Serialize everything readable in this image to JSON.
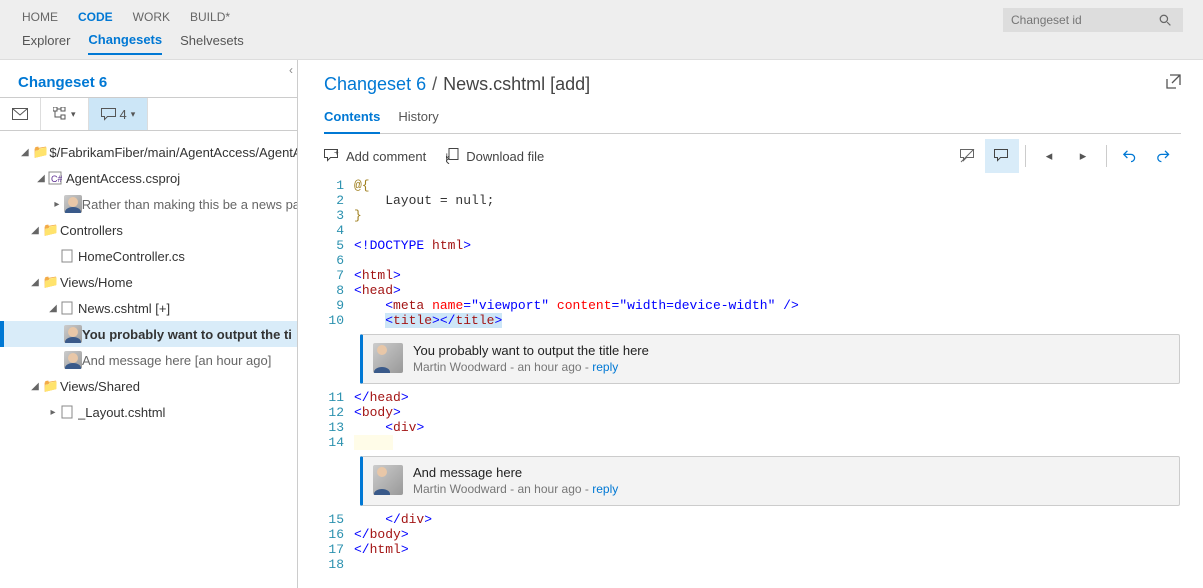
{
  "topnav": {
    "items": [
      "HOME",
      "CODE",
      "WORK",
      "BUILD*"
    ],
    "active": 1
  },
  "subnav": {
    "items": [
      "Explorer",
      "Changesets",
      "Shelvesets"
    ],
    "active": 1
  },
  "search": {
    "placeholder": "Changeset id"
  },
  "leftpanel": {
    "title": "Changeset 6",
    "comment_count": "4",
    "tree": {
      "root": "$/FabrikamFiber/main/AgentAccess/AgentA",
      "proj": "AgentAccess.csproj",
      "proj_comment": "Rather than making this be a news pa",
      "folder1": "Controllers",
      "file1": "HomeController.cs",
      "folder2": "Views/Home",
      "file2": "News.cshtml [+]",
      "file2_comment1": "You probably want to output the ti",
      "file2_comment2": "And message here [an hour ago]",
      "folder3": "Views/Shared",
      "file3": "_Layout.cshtml"
    }
  },
  "rightpanel": {
    "header_link": "Changeset 6",
    "header_rest": "News.cshtml [add]",
    "tabs": [
      "Contents",
      "History"
    ],
    "active_tab": 0,
    "toolbar": {
      "add_comment": "Add comment",
      "download": "Download file"
    },
    "code": {
      "l1": "@{",
      "l2": "    Layout = null;",
      "l3": "}",
      "l5_a": "<!DOCTYPE",
      "l5_b": " html",
      "l5_c": ">",
      "l7": "html",
      "l8": "head",
      "l9_a": "meta",
      "l9_b": "name",
      "l9_c": "\"viewport\"",
      "l9_d": "content",
      "l9_e": "\"width=device-width\"",
      "l9_f": " />",
      "l10_a": "title",
      "l10_b": "title",
      "l11": "head",
      "l12": "body",
      "l13": "div",
      "l15": "div",
      "l16": "body",
      "l17": "html"
    },
    "comment1": {
      "text": "You probably want to output the title here",
      "author": "Martin Woodward",
      "age": "an hour ago",
      "reply": "reply"
    },
    "comment2": {
      "text": "And message here",
      "author": "Martin Woodward",
      "age": "an hour ago",
      "reply": "reply"
    }
  }
}
